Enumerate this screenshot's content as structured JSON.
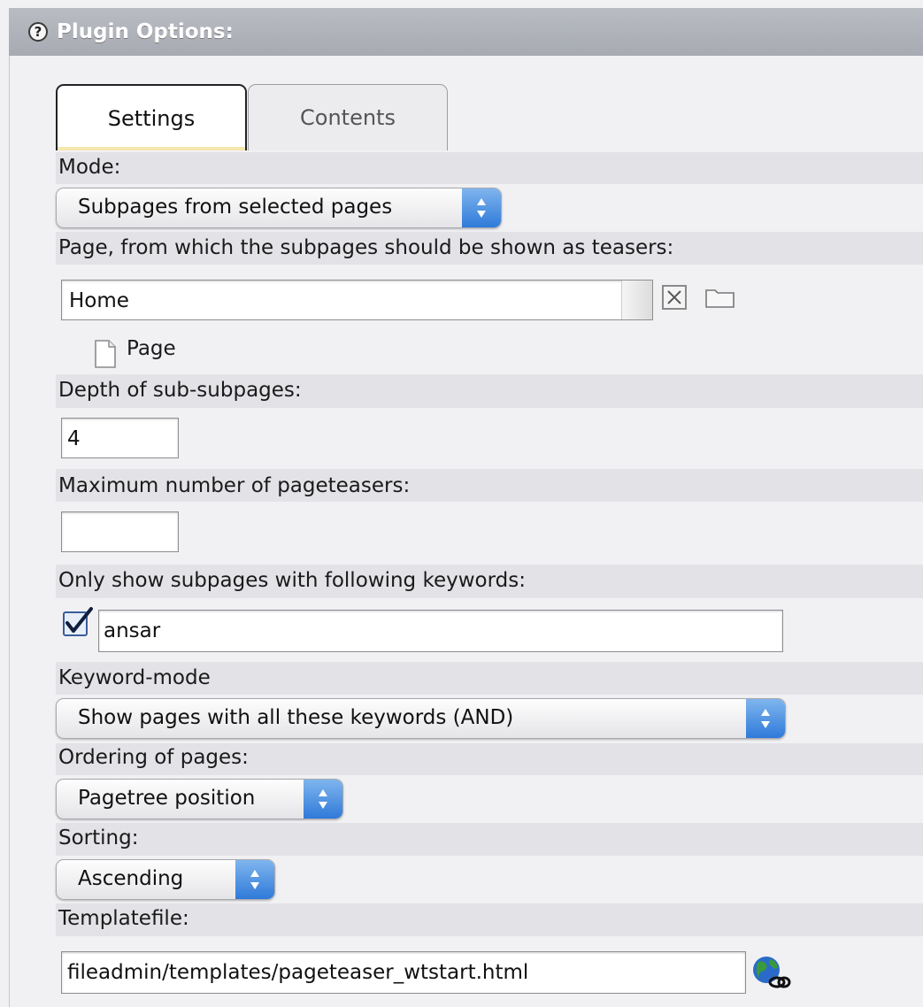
{
  "header": {
    "title": "Plugin Options:",
    "help_icon": "?"
  },
  "tabs": [
    {
      "label": "Settings",
      "active": true
    },
    {
      "label": "Contents",
      "active": false
    }
  ],
  "mode": {
    "label": "Mode:",
    "value": "Subpages from selected pages"
  },
  "page": {
    "label": "Page, from which the subpages should be shown as teasers:",
    "value": "Home",
    "record_type": "Page"
  },
  "depth": {
    "label": "Depth of sub-subpages:",
    "value": "4"
  },
  "max_teasers": {
    "label": "Maximum number of pageteasers:",
    "value": ""
  },
  "keywords": {
    "label": "Only show subpages with following keywords:",
    "checked": true,
    "value": "ansar"
  },
  "keyword_mode": {
    "label": "Keyword-mode",
    "value": "Show pages with all these keywords (AND)"
  },
  "ordering": {
    "label": "Ordering of pages:",
    "value": "Pagetree position"
  },
  "sorting": {
    "label": "Sorting:",
    "value": "Ascending"
  },
  "templatefile": {
    "label": "Templatefile:",
    "value": "fileadmin/templates/pageteaser_wtstart.html"
  },
  "colors": {
    "header": "#aeb1b8",
    "accent": "#2f7ad9",
    "band": "#e3e3e7"
  }
}
